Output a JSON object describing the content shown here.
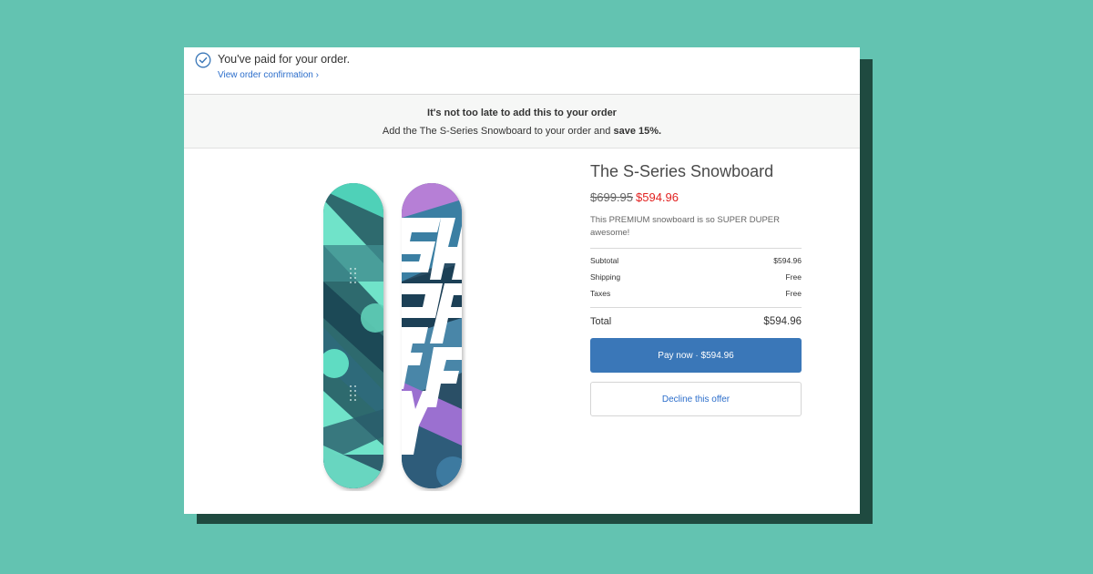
{
  "status": {
    "paid_message": "You've paid for your order.",
    "confirmation_link": "View order confirmation ›"
  },
  "upsell": {
    "headline": "It's not too late to add this to your order",
    "sub_prefix": "Add the The S-Series Snowboard to your order and ",
    "sub_bold": "save 15%."
  },
  "product": {
    "title": "The S-Series Snowboard",
    "price_original": "$699.95",
    "price_sale": "$594.96",
    "description": "This PREMIUM snowboard is so SUPER DUPER awesome!",
    "board_graphic_letters": "SHOPIFY"
  },
  "summary": {
    "subtotal_label": "Subtotal",
    "subtotal_value": "$594.96",
    "shipping_label": "Shipping",
    "shipping_value": "Free",
    "taxes_label": "Taxes",
    "taxes_value": "Free",
    "total_label": "Total",
    "total_value": "$594.96"
  },
  "actions": {
    "pay_label": "Pay now · $594.96",
    "decline_label": "Decline this offer"
  },
  "colors": {
    "background": "#63c3b1",
    "accent_button": "#3a77b8",
    "sale_price": "#e22120",
    "link": "#2c6ecb"
  }
}
